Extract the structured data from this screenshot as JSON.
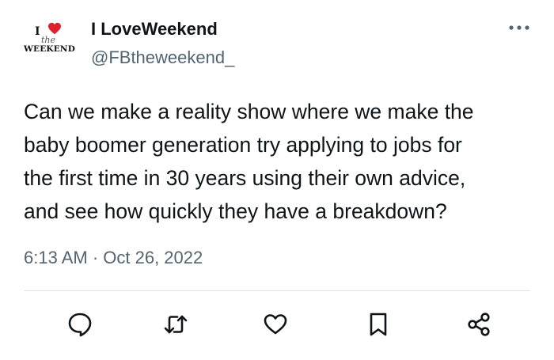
{
  "author": {
    "display_name": "I LoveWeekend",
    "handle": "@FBtheweekend_",
    "logo": {
      "letter_i": "I",
      "the": "the",
      "weekend": "WEEKEND",
      "heart_color": "#e0202a"
    }
  },
  "tweet": {
    "lines": [
      "Can we make a reality show where we make the",
      "baby boomer generation try applying to jobs for",
      "the first time in 30 years using their own advice,",
      "and see how quickly they have a breakdown?"
    ],
    "timestamp": "6:13 AM · Oct 26, 2022"
  },
  "actions": [
    {
      "name": "reply",
      "icon": "speech-bubble-icon"
    },
    {
      "name": "retweet",
      "icon": "retweet-icon"
    },
    {
      "name": "like",
      "icon": "heart-icon"
    },
    {
      "name": "bookmark",
      "icon": "bookmark-icon"
    },
    {
      "name": "share",
      "icon": "share-icon"
    }
  ],
  "colors": {
    "text": "#0f1419",
    "secondary": "#536471",
    "divider": "#dde3e7"
  }
}
